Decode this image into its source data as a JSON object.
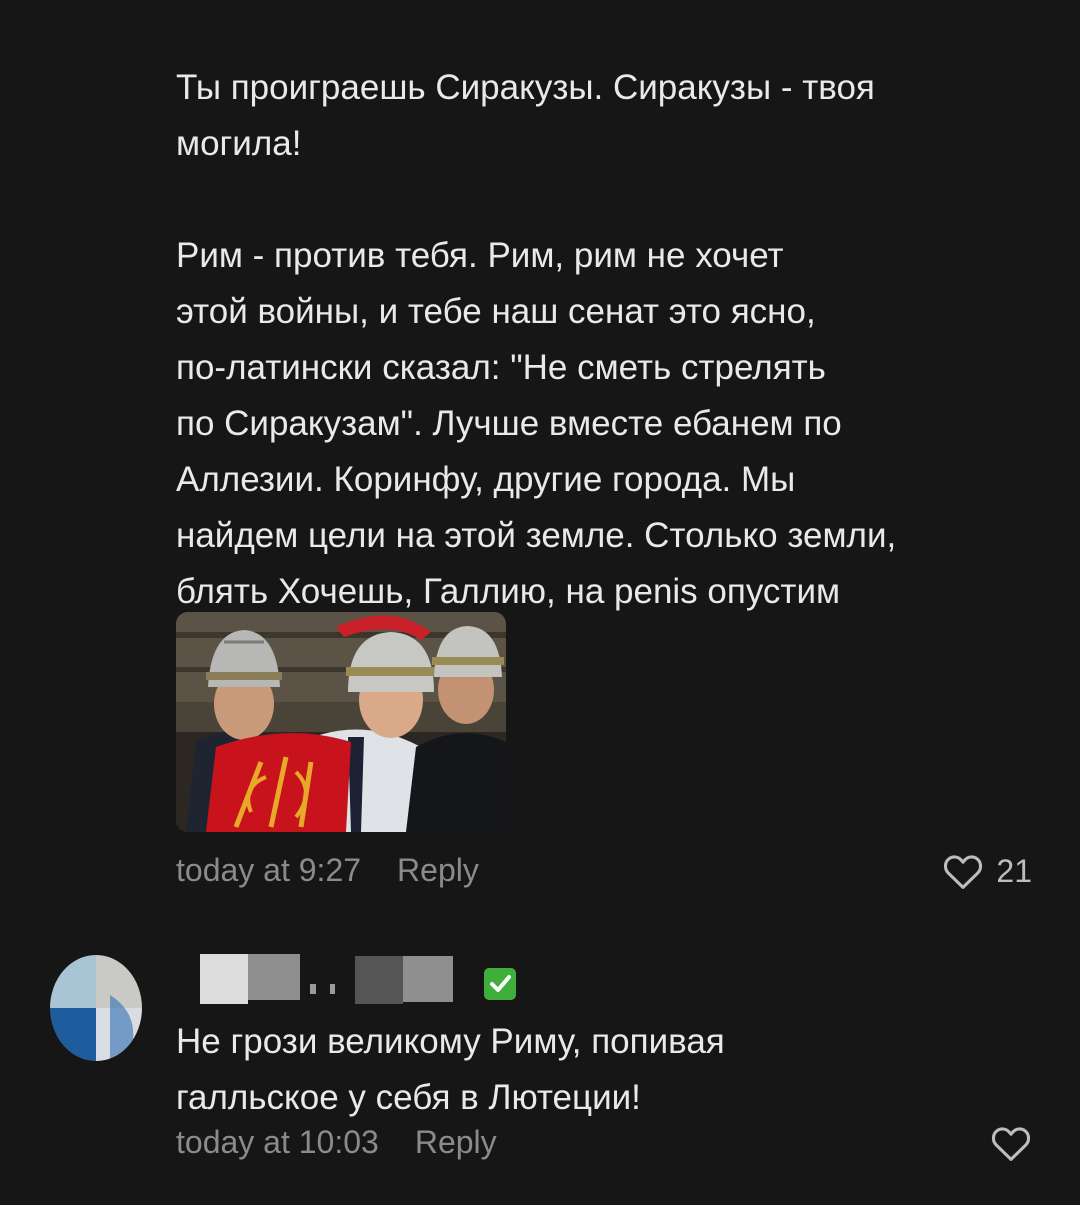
{
  "comments": [
    {
      "text": "Ты проиграешь Сиракузы. Сиракузы - твоя\nмогила!\n\nРим - против тебя. Рим, рим не хочет\nэтой войны, и тебе наш сенат это ясно,\nпо-латински сказал: \"Не сметь стрелять\nпо Сиракузам\". Лучше вместе ебанем по\nАллезии. Коринфу, другие города. Мы\nнайдем цели на этой земле. Столько земли,\nблять Хочешь, Галлию, на penis опустим",
      "time": "today at 9:27",
      "reply_label": "Reply",
      "likes": "21"
    },
    {
      "verified_icon": "check-mark-icon",
      "text": "Не грози великому Риму, попивая\nгалльское у себя в Лютеции!",
      "time": "today at 10:03",
      "reply_label": "Reply"
    }
  ],
  "colors": {
    "background": "#161616",
    "text": "#e9e9e9",
    "meta": "#8b8b8b",
    "verified": "#3fae3a"
  }
}
